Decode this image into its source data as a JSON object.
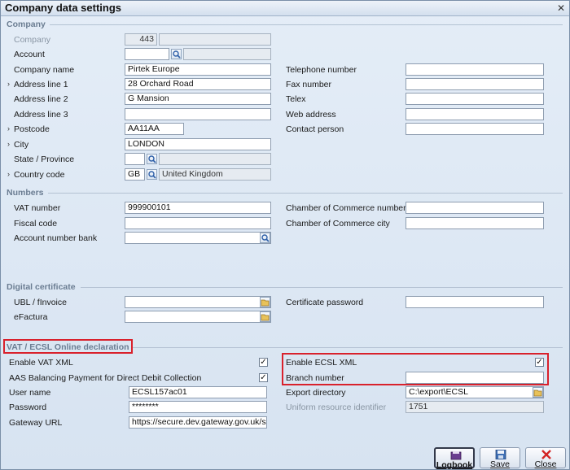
{
  "window": {
    "title": "Company data settings"
  },
  "sections": {
    "company": "Company",
    "numbers": "Numbers",
    "digital_certificate": "Digital certificate",
    "vat_ecsl": "VAT / ECSL Online declaration"
  },
  "company": {
    "company_label": "Company",
    "company_value": "443",
    "account_label": "Account",
    "account_value": "",
    "company_name_label": "Company name",
    "company_name_value": "Pirtek Europe",
    "address1_label": "Address line 1",
    "address1_value": "28 Orchard Road",
    "address2_label": "Address line 2",
    "address2_value": "G Mansion",
    "address3_label": "Address line 3",
    "address3_value": "",
    "postcode_label": "Postcode",
    "postcode_value": "AA11AA",
    "city_label": "City",
    "city_value": "LONDON",
    "state_label": "State / Province",
    "state_value": "",
    "country_label": "Country code",
    "country_code_value": "GB",
    "country_name_value": "United Kingdom",
    "telephone_label": "Telephone number",
    "telephone_value": "",
    "fax_label": "Fax number",
    "fax_value": "",
    "telex_label": "Telex",
    "telex_value": "",
    "web_label": "Web address",
    "web_value": "",
    "contact_label": "Contact person",
    "contact_value": ""
  },
  "numbers": {
    "vat_label": "VAT number",
    "vat_value": "999900101",
    "fiscal_label": "Fiscal code",
    "fiscal_value": "",
    "bank_label": "Account number bank",
    "bank_value": "",
    "coc_number_label": "Chamber of Commerce number",
    "coc_number_value": "",
    "coc_city_label": "Chamber of Commerce city",
    "coc_city_value": ""
  },
  "certificate": {
    "ubl_label": "UBL / fInvoice",
    "ubl_value": "",
    "efactura_label": "eFactura",
    "efactura_value": "",
    "cert_password_label": "Certificate password",
    "cert_password_value": ""
  },
  "vat": {
    "enable_vat_xml_label": "Enable VAT XML",
    "enable_vat_xml_mark": "✓",
    "aas_label": "AAS Balancing Payment for Direct Debit Collection",
    "aas_mark": "✓",
    "user_label": "User name",
    "user_value": "ECSL157ac01",
    "password_label": "Password",
    "password_value": "********",
    "gateway_label": "Gateway URL",
    "gateway_value": "https://secure.dev.gateway.gov.uk/su",
    "enable_ecsl_label": "Enable ECSL XML",
    "enable_ecsl_mark": "✓",
    "branch_label": "Branch number",
    "branch_value": "",
    "export_dir_label": "Export directory",
    "export_dir_value": "C:\\export\\ECSL",
    "uri_label": "Uniform resource identifier",
    "uri_value": "1751"
  },
  "buttons": {
    "logbook": "Logbook",
    "save": "Save",
    "close": "Close"
  },
  "icons": {
    "lookup": "magnifier-icon",
    "folder": "folder-icon"
  },
  "colors": {
    "highlight": "#d9212c",
    "background": "#dde8f4"
  }
}
